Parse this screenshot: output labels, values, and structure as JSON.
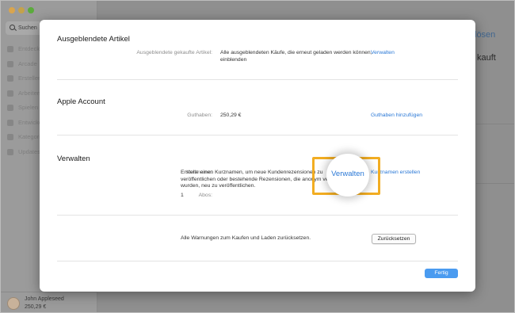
{
  "background_app": {
    "search_placeholder": "Suchen",
    "sidebar_items": [
      {
        "label": "Entdecken",
        "icon": "star-icon"
      },
      {
        "label": "Arcade",
        "icon": "joystick-icon"
      },
      {
        "label": "Erstellen",
        "icon": "brush-icon"
      },
      {
        "label": "Arbeiten",
        "icon": "paperplane-icon"
      },
      {
        "label": "Spielen",
        "icon": "rocket-icon"
      },
      {
        "label": "Entwickeln",
        "icon": "hammer-icon"
      },
      {
        "label": "Kategorien",
        "icon": "grid-icon"
      },
      {
        "label": "Updates",
        "icon": "download-icon"
      }
    ],
    "user_name": "John Appleseed",
    "user_balance": "250,29 €",
    "right_link_fragment": "lösen",
    "right_text_fragment": "kauft"
  },
  "sheet": {
    "hidden_items": {
      "title": "Ausgeblendete Artikel",
      "label": "Ausgeblendete gekaufte Artikel:",
      "description": "Alle ausgeblendeten Käufe, die erneut geladen werden können, einblenden",
      "action": "Verwalten"
    },
    "account": {
      "title": "Apple Account",
      "label": "Guthaben:",
      "value": "250,29 €",
      "action": "Guthaben hinzufügen"
    },
    "manage": {
      "title": "Verwalten",
      "nickname_label": "Kurzname:",
      "nickname_text": "Erstelle einen Kurznamen, um neue Kundenrezensionen zu veröffentlichen oder bestehende Rezensionen, die anonym veröffentlicht wurden, neu zu veröffentlichen.",
      "nickname_action": "Kurznamen erstellen",
      "subs_label": "Abos:",
      "subs_value": "1",
      "subs_action": "Verwalten"
    },
    "reset": {
      "text": "Alle Warnungen zum Kaufen und Laden zurücksetzen.",
      "button": "Zurücksetzen"
    },
    "done_button": "Fertig"
  },
  "colors": {
    "link": "#2a78d6",
    "primary_button": "#4a9bf0",
    "highlight": "#f2ad22"
  }
}
